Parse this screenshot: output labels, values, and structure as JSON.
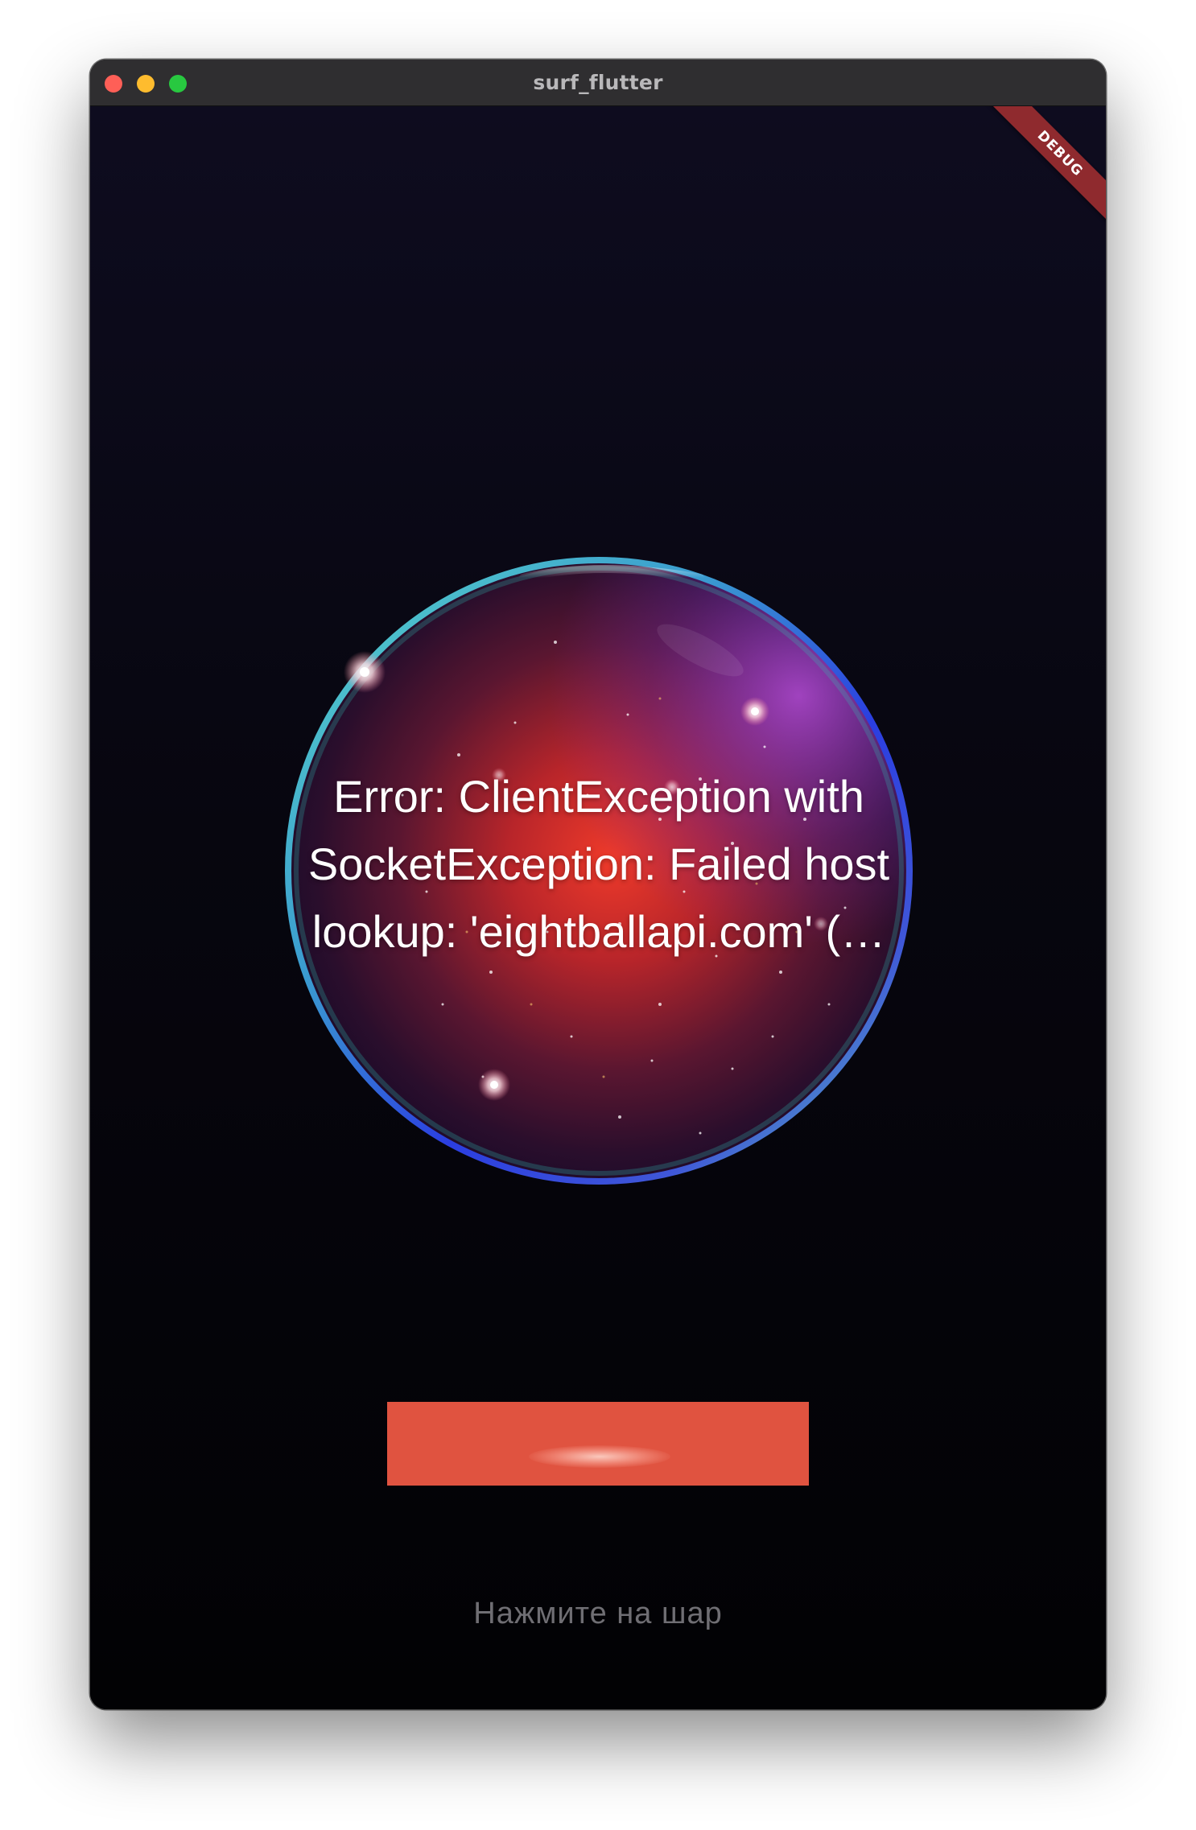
{
  "window": {
    "title": "surf_flutter"
  },
  "debug_banner": {
    "label": "DEBUG"
  },
  "ball": {
    "message": "Error: ClientException with SocketException: Failed host lookup: 'eightballapi.com' (…"
  },
  "hint": {
    "text": "Нажмите на шар"
  },
  "colors": {
    "button": "#e05340",
    "background_top": "#0e0c1f",
    "background_bottom": "#020204",
    "ball_core": "#e8342a",
    "ball_rim_teal": "#4fd1c5",
    "ball_rim_blue": "#2b3ee0",
    "debug_banner": "#8f2a2e"
  },
  "icons": {
    "close": "traffic-light-close-icon",
    "minimize": "traffic-light-minimize-icon",
    "maximize": "traffic-light-maximize-icon"
  }
}
